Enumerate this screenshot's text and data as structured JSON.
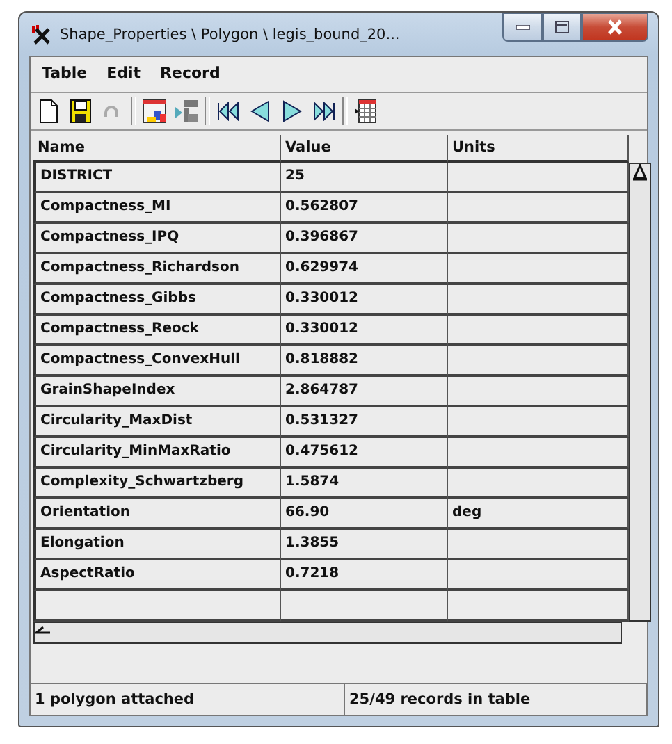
{
  "window": {
    "title": "Shape_Properties \\ Polygon \\ legis_bound_20..."
  },
  "menu": [
    "Table",
    "Edit",
    "Record"
  ],
  "table": {
    "columns": [
      "Name",
      "Value",
      "Units"
    ],
    "rows": [
      {
        "name": "DISTRICT",
        "value": "25",
        "units": ""
      },
      {
        "name": "Compactness_MI",
        "value": "0.562807",
        "units": ""
      },
      {
        "name": "Compactness_IPQ",
        "value": "0.396867",
        "units": ""
      },
      {
        "name": "Compactness_Richardson",
        "value": "0.629974",
        "units": ""
      },
      {
        "name": "Compactness_Gibbs",
        "value": "0.330012",
        "units": ""
      },
      {
        "name": "Compactness_Reock",
        "value": "0.330012",
        "units": ""
      },
      {
        "name": "Compactness_ConvexHull",
        "value": "0.818882",
        "units": ""
      },
      {
        "name": "GrainShapeIndex",
        "value": "2.864787",
        "units": ""
      },
      {
        "name": "Circularity_MaxDist",
        "value": "0.531327",
        "units": ""
      },
      {
        "name": "Circularity_MinMaxRatio",
        "value": "0.475612",
        "units": ""
      },
      {
        "name": "Complexity_Schwartzberg",
        "value": "1.5874",
        "units": ""
      },
      {
        "name": "Orientation",
        "value": "66.90",
        "units": "deg"
      },
      {
        "name": "Elongation",
        "value": "1.3855",
        "units": ""
      },
      {
        "name": "AspectRatio",
        "value": "0.7218",
        "units": ""
      }
    ]
  },
  "status_bar": [
    "1 polygon attached",
    "25/49 records in table"
  ]
}
